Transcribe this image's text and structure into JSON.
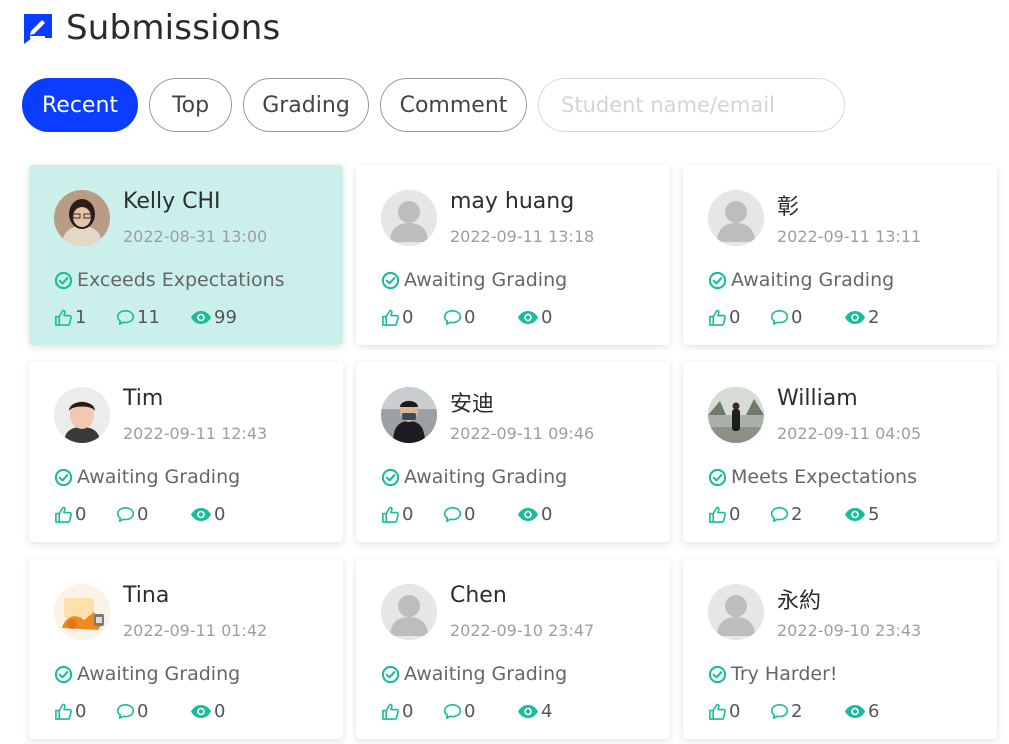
{
  "page": {
    "title": "Submissions"
  },
  "filters": {
    "tabs": [
      {
        "label": "Recent",
        "active": true
      },
      {
        "label": "Top",
        "active": false
      },
      {
        "label": "Grading",
        "active": false
      },
      {
        "label": "Comment",
        "active": false
      }
    ],
    "search_placeholder": "Student name/email",
    "search_value": ""
  },
  "colors": {
    "accent": "#0a3dff",
    "teal": "#1abc9c",
    "highlight_card": "#cbf0ec"
  },
  "cards": [
    {
      "name": "Kelly CHI",
      "date": "2022-08-31 13:00",
      "status": "Exceeds Expectations",
      "likes": "1",
      "comments": "11",
      "views": "99",
      "avatar": "photo-woman-glasses",
      "highlighted": true
    },
    {
      "name": "may huang",
      "date": "2022-09-11 13:18",
      "status": "Awaiting Grading",
      "likes": "0",
      "comments": "0",
      "views": "0",
      "avatar": "default-user-avatar",
      "highlighted": false
    },
    {
      "name": "彰",
      "date": "2022-09-11 13:11",
      "status": "Awaiting Grading",
      "likes": "0",
      "comments": "0",
      "views": "2",
      "avatar": "default-user-avatar",
      "highlighted": false
    },
    {
      "name": "Tim",
      "date": "2022-09-11 12:43",
      "status": "Awaiting Grading",
      "likes": "0",
      "comments": "0",
      "views": "0",
      "avatar": "photo-young-man",
      "highlighted": false
    },
    {
      "name": "安迪",
      "date": "2022-09-11 09:46",
      "status": "Awaiting Grading",
      "likes": "0",
      "comments": "0",
      "views": "0",
      "avatar": "photo-man-mask",
      "highlighted": false
    },
    {
      "name": "William",
      "date": "2022-09-11 04:05",
      "status": "Meets Expectations",
      "likes": "0",
      "comments": "2",
      "views": "5",
      "avatar": "photo-man-outdoor",
      "highlighted": false
    },
    {
      "name": "Tina",
      "date": "2022-09-11 01:42",
      "status": "Awaiting Grading",
      "likes": "0",
      "comments": "0",
      "views": "0",
      "avatar": "illustration-orange",
      "highlighted": false
    },
    {
      "name": "Chen",
      "date": "2022-09-10 23:47",
      "status": "Awaiting Grading",
      "likes": "0",
      "comments": "0",
      "views": "4",
      "avatar": "default-user-avatar",
      "highlighted": false
    },
    {
      "name": "永約",
      "date": "2022-09-10 23:43",
      "status": "Try Harder!",
      "likes": "0",
      "comments": "2",
      "views": "6",
      "avatar": "default-user-avatar",
      "highlighted": false
    }
  ]
}
